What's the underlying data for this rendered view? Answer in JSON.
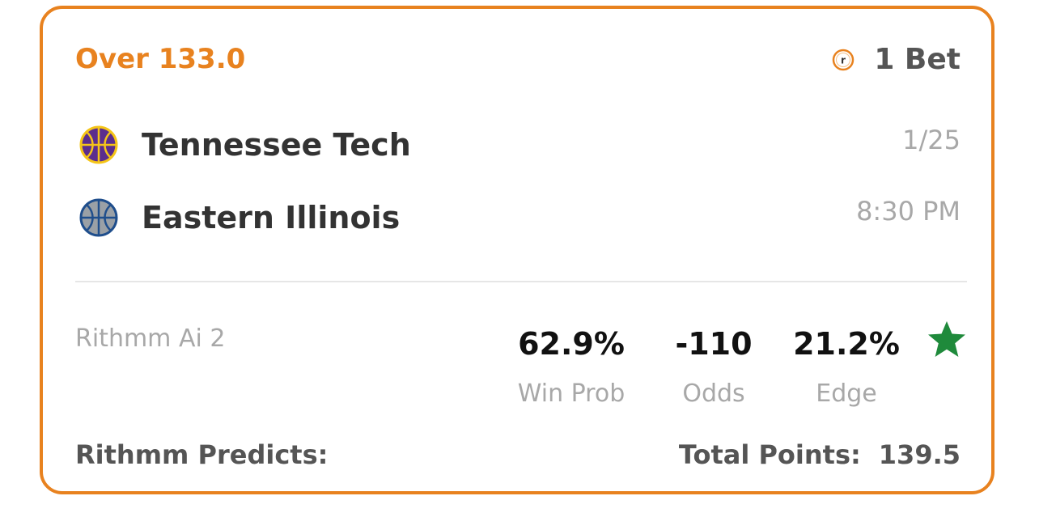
{
  "bet": {
    "pick": "Over 133.0",
    "bets_icon": "rithmm-coin-icon",
    "bets_label": "1 Bet"
  },
  "teams": [
    {
      "name": "Tennessee Tech",
      "logo_icon": "basketball-icon",
      "logo_color": "#5b2d8e",
      "logo_line_color": "#f5c518"
    },
    {
      "name": "Eastern Illinois",
      "logo_icon": "basketball-icon",
      "logo_color": "#9aa0a6",
      "logo_line_color": "#1f4e8c"
    }
  ],
  "game": {
    "date": "1/25",
    "time": "8:30 PM"
  },
  "model": {
    "name": "Rithmm Ai 2"
  },
  "stats": {
    "win_prob": {
      "value": "62.9%",
      "label": "Win Prob"
    },
    "odds": {
      "value": "-110",
      "label": "Odds"
    },
    "edge": {
      "value": "21.2%",
      "label": "Edge"
    },
    "star_icon": "star-icon",
    "star_color": "#1f8a3b"
  },
  "prediction": {
    "label": "Rithmm Predicts:",
    "metric_label": "Total Points:",
    "metric_value": "139.5"
  },
  "colors": {
    "accent": "#e8821f",
    "muted": "#a8a8a8",
    "text_dark": "#333333"
  }
}
